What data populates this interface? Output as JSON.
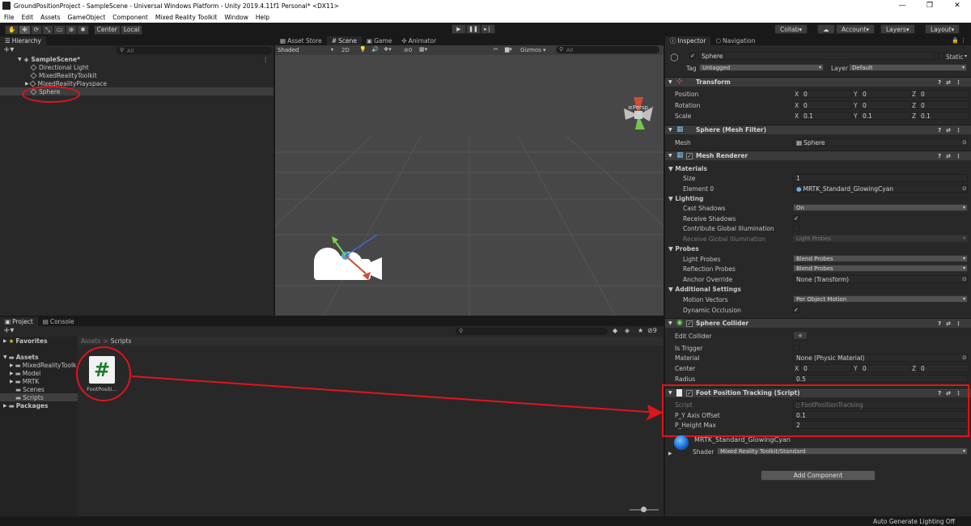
{
  "window": {
    "title": "GroundPositionProject - SampleScene - Universal Windows Platform - Unity 2019.4.11f1 Personal* <DX11>",
    "controls": [
      "—",
      "❐",
      "✕"
    ]
  },
  "menu": [
    "File",
    "Edit",
    "Assets",
    "GameObject",
    "Component",
    "Mixed Reality Toolkit",
    "Window",
    "Help"
  ],
  "toolbar": {
    "center": "Center",
    "local": "Local",
    "collab": "Collab",
    "account": "Account",
    "layers": "Layers",
    "layout": "Layout"
  },
  "hierarchy": {
    "tab": "Hierarchy",
    "search": "All",
    "scene": "SampleScene*",
    "items": [
      "Directional Light",
      "MixedRealityToolkit",
      "MixedRealityPlayspace",
      "Sphere"
    ]
  },
  "scene_tabs": [
    "Asset Store",
    "Scene",
    "Game",
    "Animator"
  ],
  "scene_toolbar": {
    "shading": "Shaded",
    "mode2d": "2D",
    "fx_count": "0",
    "gizmos": "Gizmos",
    "search": "All",
    "persp": "Persp"
  },
  "project": {
    "tabs": [
      "Project",
      "Console"
    ],
    "favorites": "Favorites",
    "assets": "Assets",
    "folders": [
      "MixedRealityToolk",
      "Model",
      "MRTK",
      "Scenes",
      "Scripts"
    ],
    "packages": "Packages",
    "breadcrumb": [
      "Assets",
      ">",
      "Scripts"
    ],
    "file": "FootPositi...",
    "hidden_count": "9"
  },
  "inspector": {
    "tabs": [
      "Inspector",
      "Navigation"
    ],
    "name": "Sphere",
    "static": "Static",
    "tag_label": "Tag",
    "tag": "Untagged",
    "layer_label": "Layer",
    "layer": "Default",
    "transform": {
      "title": "Transform",
      "rows": [
        {
          "label": "Position",
          "x": "0",
          "y": "0",
          "z": "0"
        },
        {
          "label": "Rotation",
          "x": "0",
          "y": "0",
          "z": "0"
        },
        {
          "label": "Scale",
          "x": "0.1",
          "y": "0.1",
          "z": "0.1"
        }
      ]
    },
    "mesh_filter": {
      "title": "Sphere (Mesh Filter)",
      "label": "Mesh",
      "value": "Sphere"
    },
    "mesh_renderer": {
      "title": "Mesh Renderer",
      "materials": "Materials",
      "size_label": "Size",
      "size": "1",
      "element_label": "Element 0",
      "element": "MRTK_Standard_GlowingCyan",
      "lighting": "Lighting",
      "cast_label": "Cast Shadows",
      "cast": "On",
      "receive_label": "Receive Shadows",
      "gi_label": "Contribute Global Illumination",
      "rgi_label": "Receive Global Illumination",
      "rgi": "Light Probes",
      "probes": "Probes",
      "lp_label": "Light Probes",
      "lp": "Blend Probes",
      "rp_label": "Reflection Probes",
      "rp": "Blend Probes",
      "ao_label": "Anchor Override",
      "ao": "None (Transform)",
      "additional": "Additional Settings",
      "mv_label": "Motion Vectors",
      "mv": "Per Object Motion",
      "do_label": "Dynamic Occlusion"
    },
    "collider": {
      "title": "Sphere Collider",
      "edit_label": "Edit Collider",
      "trigger_label": "Is Trigger",
      "material_label": "Material",
      "material": "None (Physic Material)",
      "center_label": "Center",
      "cx": "0",
      "cy": "0",
      "cz": "0",
      "radius_label": "Radius",
      "radius": "0.5"
    },
    "script": {
      "title": "Foot Position Tracking (Script)",
      "script_label": "Script",
      "script": "FootPositionTracking",
      "p1_label": "P_Y Axis Offset",
      "p1": "0.1",
      "p2_label": "P_Height Max",
      "p2": "2"
    },
    "material": {
      "name": "MRTK_Standard_GlowingCyan",
      "shader_label": "Shader",
      "shader": "Mixed Reality Toolkit/Standard"
    },
    "add_component": "Add Component"
  },
  "status": "Auto Generate Lighting Off",
  "colors": {
    "annotation": "#e0141c",
    "accent": "#3a79bb"
  }
}
